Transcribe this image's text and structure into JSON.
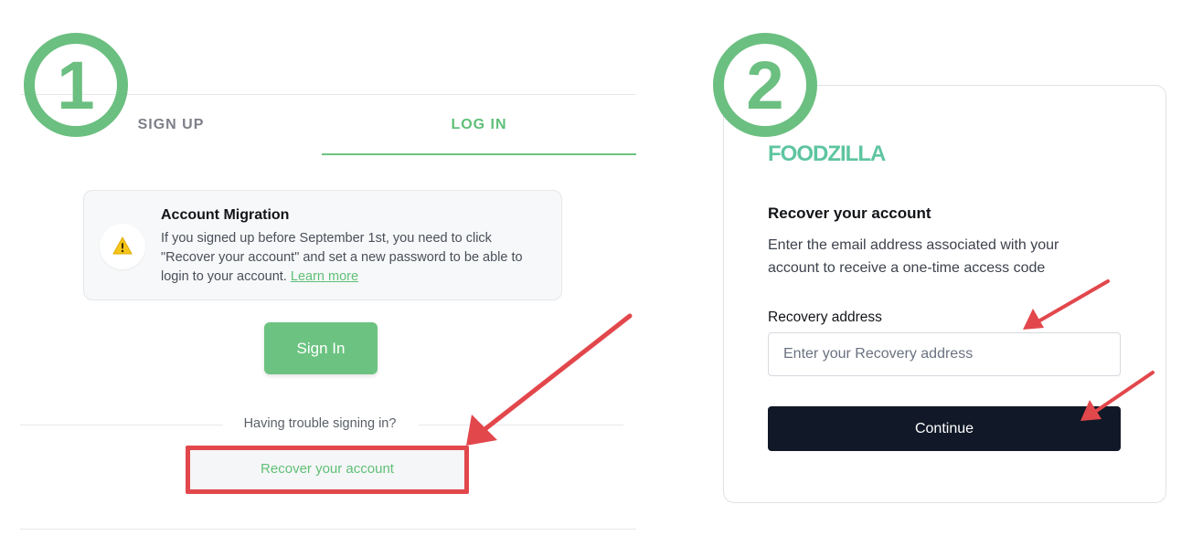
{
  "steps": {
    "one": "1",
    "two": "2"
  },
  "left_panel": {
    "tabs": [
      {
        "label": "SIGN UP",
        "active": false
      },
      {
        "label": "LOG IN",
        "active": true
      }
    ],
    "notice": {
      "icon": "warning-icon",
      "title": "Account Migration",
      "body": "If you signed up before September 1st, you need to click \"Recover your account\" and set a new password to be able to login to your account.",
      "link": "Learn more"
    },
    "signin_button": "Sign In",
    "trouble_text": "Having trouble signing in?",
    "recover_button": "Recover your account"
  },
  "right_panel": {
    "brand": "FOODZILLA",
    "title": "Recover your account",
    "description": "Enter the email address associated with your account to receive a one-time access code",
    "field_label": "Recovery address",
    "field_placeholder": "Enter your Recovery address",
    "field_value": "",
    "continue_button": "Continue"
  },
  "colors": {
    "accent_green": "#6cc381",
    "brand_teal": "#5ec5a0",
    "annotation_red": "#e2474c",
    "badge_green": "#6bbf80",
    "dark_button": "#111827"
  }
}
